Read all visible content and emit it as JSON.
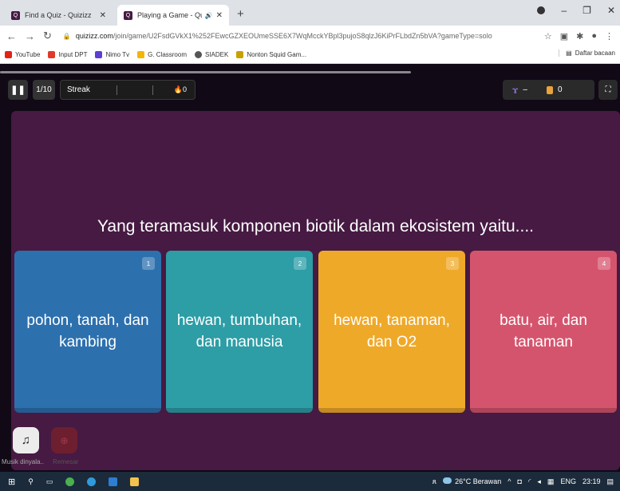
{
  "browser": {
    "tabs": [
      {
        "title": "Find a Quiz - Quizizz",
        "favicon": "Q",
        "active": false
      },
      {
        "title": "Playing a Game - Quizizz",
        "favicon": "Q",
        "active": true
      }
    ],
    "new_tab": "+",
    "url_domain": "quizizz.com",
    "url_path": "/join/game/U2FsdGVkX1%252FEwcGZXEOUmeSSE6X7WqMcckYBpl3pujoS8qlzJ6KiPrFLbdZn5bVA?gameType=solo",
    "bookmarks": [
      {
        "label": "YouTube",
        "color": "#e62117"
      },
      {
        "label": "Input DPT",
        "color": "#e0392b"
      },
      {
        "label": "Nimo Tv",
        "color": "#5b3fd6"
      },
      {
        "label": "G. Classroom",
        "color": "#f5b400"
      },
      {
        "label": "SIADEK",
        "color": "#555555"
      },
      {
        "label": "Nonton Squid Gam...",
        "color": "#c8a000"
      }
    ],
    "reading_list": "Daftar bacaan"
  },
  "game": {
    "question_counter": "1/10",
    "streak_label": "Streak",
    "streak_value": "0",
    "powerup_value": "–",
    "coins_value": "0",
    "question": "Yang teramasuk komponen biotik dalam ekosistem yaitu....",
    "options": [
      {
        "number": "1",
        "text": "pohon, tanah, dan kambing",
        "color": "#2d70ae"
      },
      {
        "number": "2",
        "text": "hewan, tumbuhan, dan manusia",
        "color": "#2d9da6"
      },
      {
        "number": "3",
        "text": "hewan, tanaman, dan O2",
        "color": "#efa929"
      },
      {
        "number": "4",
        "text": "batu, air, dan tanaman",
        "color": "#d5546d"
      }
    ],
    "music_label": "Musik dinyala..",
    "remesar_label": "Remesar"
  },
  "taskbar": {
    "weather": "26°C Berawan",
    "language": "ENG",
    "time": "23:19"
  },
  "colors": {
    "question_bg": "#461a42",
    "game_bg": "#110916"
  }
}
